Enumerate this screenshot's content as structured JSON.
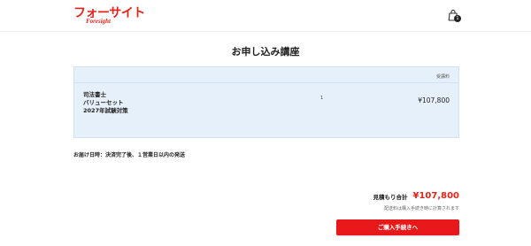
{
  "header": {
    "logo_text": "フォーサイト",
    "logo_subtext": "Foresight",
    "cart_icon": "shopping-bag-icon",
    "cart_count": "1"
  },
  "page_title": "お申し込み講座",
  "order": {
    "fee_column_label": "受講料",
    "items": [
      {
        "name_lines": [
          "司法書士",
          "バリューセット",
          "2027年試験対策"
        ],
        "quantity": "1",
        "price": "¥107,800"
      }
    ]
  },
  "delivery_info": "お届け日時：決済完了後、１営業日以内の発送",
  "summary": {
    "total_label": "見積もり合計",
    "total_value": "¥107,800",
    "shipping_note": "配送料は購入手続き時に計算されます"
  },
  "checkout_button": "ご購入手続きへ",
  "colors": {
    "brand_red": "#e1251b",
    "order_box_bg": "#e6f0fa"
  }
}
